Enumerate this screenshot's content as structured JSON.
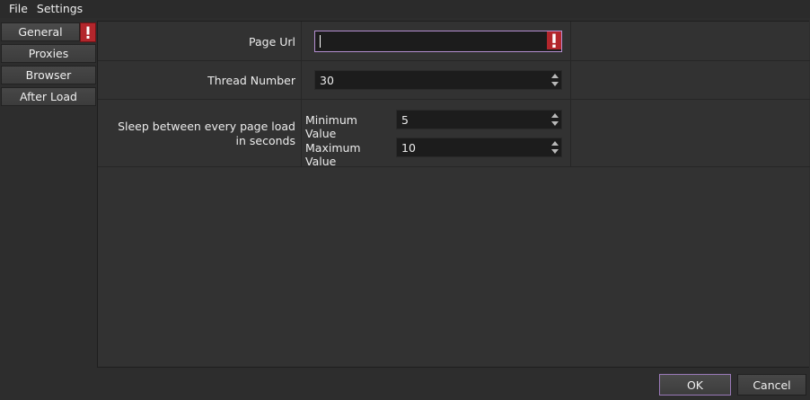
{
  "menubar": {
    "file": "File",
    "settings": "Settings"
  },
  "sidebar": {
    "items": [
      {
        "label": "General",
        "has_error": true
      },
      {
        "label": "Proxies"
      },
      {
        "label": "Browser"
      },
      {
        "label": "After Load"
      }
    ]
  },
  "form": {
    "page_url": {
      "label": "Page Url",
      "value": "",
      "has_error": true
    },
    "thread_number": {
      "label": "Thread Number",
      "value": "30"
    },
    "sleep": {
      "label": "Sleep between every page load in seconds",
      "min_label": "Minimum Value",
      "min_value": "5",
      "max_label": "Maximum Value",
      "max_value": "10"
    }
  },
  "buttons": {
    "ok": "OK",
    "cancel": "Cancel"
  },
  "colors": {
    "accent": "#b48fd1",
    "error": "#b3262c",
    "background": "#2d2d2d"
  },
  "icons": {
    "error": "exclamation-icon",
    "spin": "spin-arrows"
  }
}
